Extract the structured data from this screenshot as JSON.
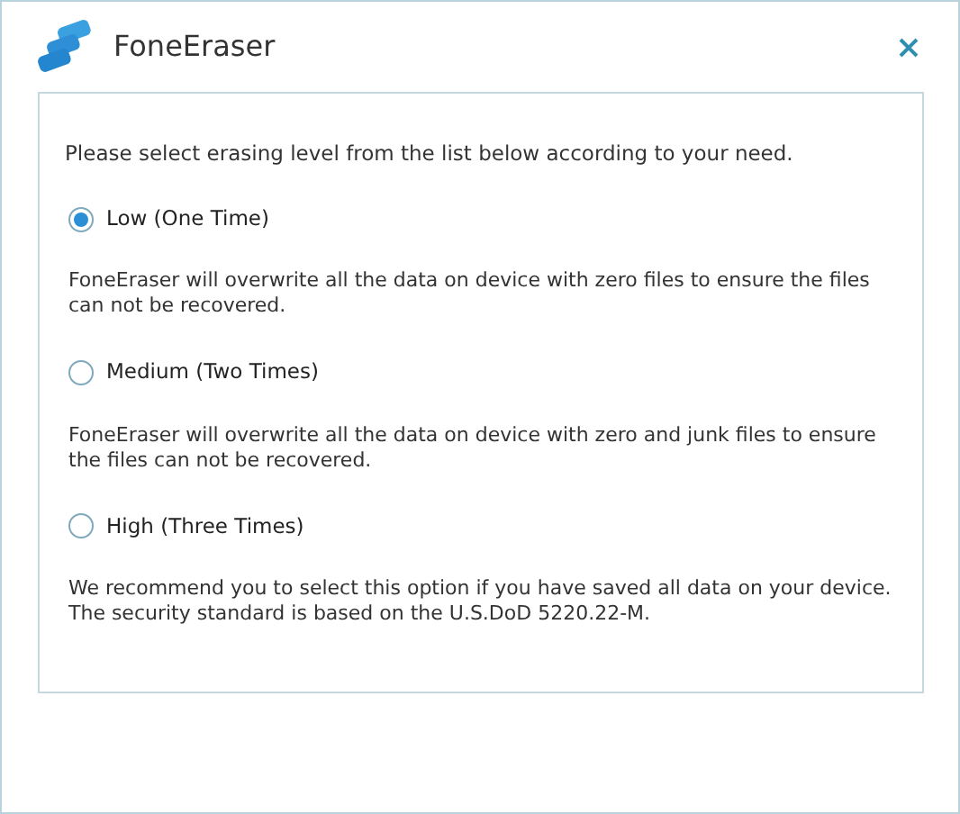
{
  "window": {
    "title": "FoneEraser"
  },
  "intro": "Please select erasing level from the list below according to your need.",
  "options": [
    {
      "label": "Low (One Time)",
      "selected": true,
      "description": "FoneEraser will overwrite all the data on device with zero files to ensure the files can not be recovered."
    },
    {
      "label": "Medium (Two Times)",
      "selected": false,
      "description": "FoneEraser will overwrite all the data on device with zero and junk files to ensure the files can not be recovered."
    },
    {
      "label": "High (Three Times)",
      "selected": false,
      "description": "We recommend you to select this option if you have saved all data on your device. The security standard is based on the U.S.DoD 5220.22-M."
    }
  ]
}
